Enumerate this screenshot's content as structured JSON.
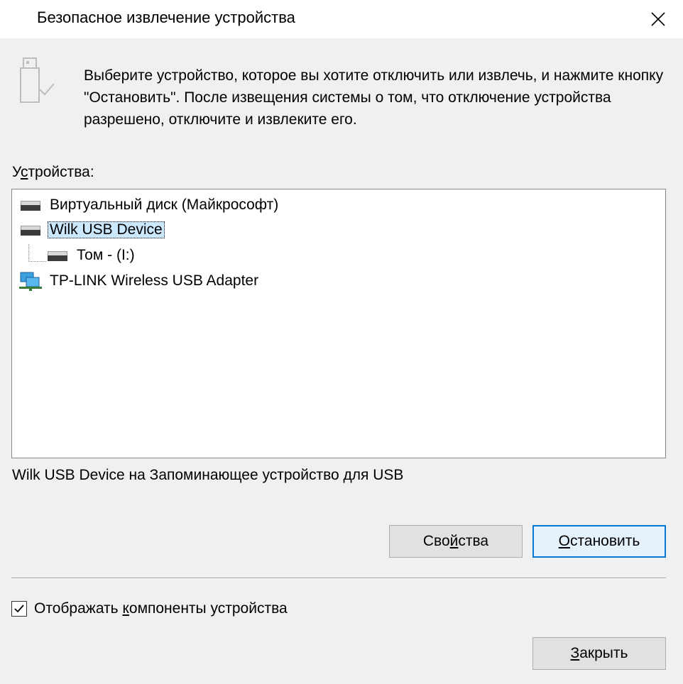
{
  "window": {
    "title": "Безопасное извлечение устройства",
    "close_icon": "close-icon"
  },
  "header": {
    "icon": "usb-drive-icon",
    "instructions": "Выберите устройство, которое вы хотите отключить или извлечь, и нажмите кнопку \"Остановить\". После извещения системы о том, что отключение устройства разрешено, отключите и извлеките его."
  },
  "devices": {
    "label_prefix": "У",
    "label_accel": "с",
    "label_suffix": "тройства:",
    "items": [
      {
        "label": "Виртуальный диск (Майкрософт)",
        "icon": "drive-icon",
        "selected": false,
        "level": 0
      },
      {
        "label": "Wilk USB Device",
        "icon": "drive-icon",
        "selected": true,
        "level": 0
      },
      {
        "label": "Том - (I:)",
        "icon": "drive-icon",
        "selected": false,
        "level": 1
      },
      {
        "label": "TP-LINK Wireless USB Adapter",
        "icon": "network-adapter-icon",
        "selected": false,
        "level": 0
      }
    ]
  },
  "status": {
    "text": "Wilk USB Device на Запоминающее устройство для USB"
  },
  "buttons": {
    "properties_prefix": "Сво",
    "properties_accel": "й",
    "properties_suffix": "ства",
    "stop_prefix": "",
    "stop_accel": "О",
    "stop_suffix": "становить",
    "close_prefix": "",
    "close_accel": "З",
    "close_suffix": "акрыть"
  },
  "options": {
    "show_components_checked": true,
    "show_components_prefix": "Отображать ",
    "show_components_accel": "к",
    "show_components_suffix": "омпоненты устройства"
  },
  "colors": {
    "selection": "#cce8ff",
    "accent": "#0078d7",
    "background": "#f0f0f0"
  }
}
